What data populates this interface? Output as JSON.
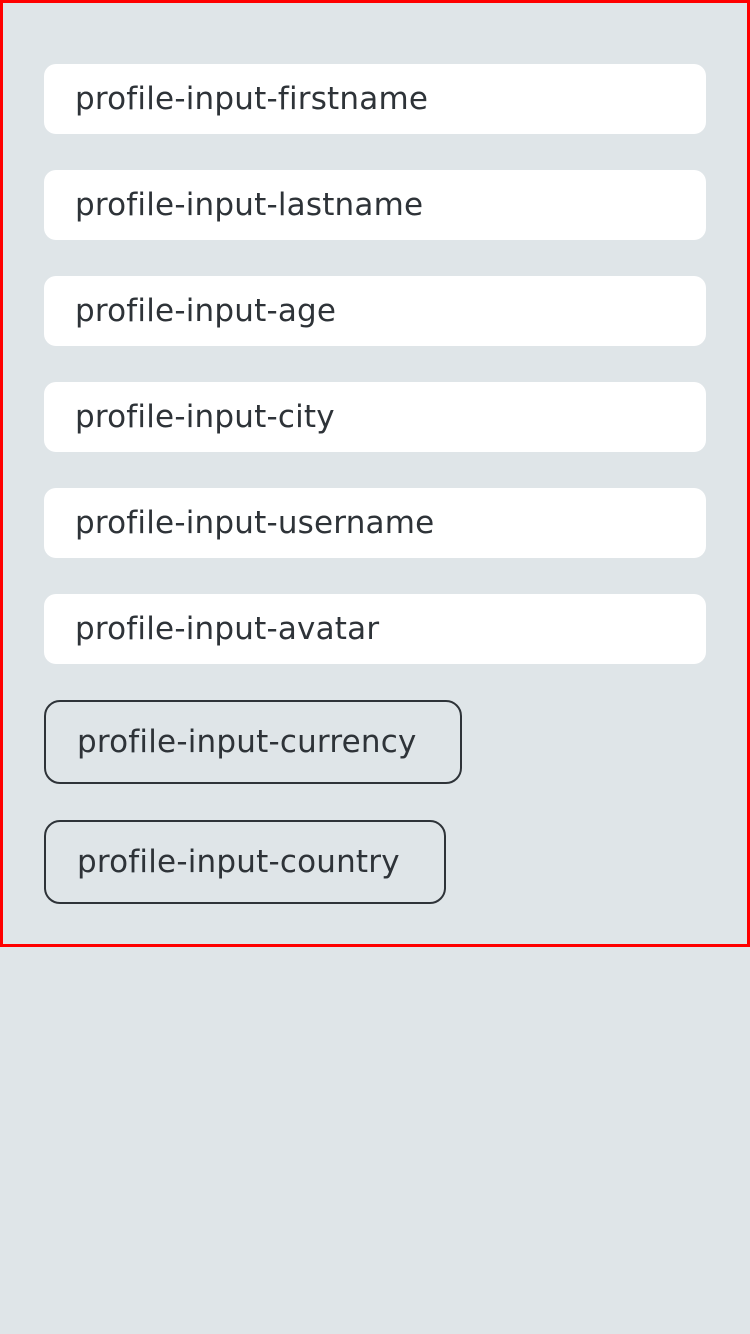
{
  "form": {
    "fields": [
      {
        "label": "profile-input-firstname"
      },
      {
        "label": "profile-input-lastname"
      },
      {
        "label": "profile-input-age"
      },
      {
        "label": "profile-input-city"
      },
      {
        "label": "profile-input-username"
      },
      {
        "label": "profile-input-avatar"
      }
    ],
    "selectors": [
      {
        "label": "profile-input-currency"
      },
      {
        "label": "profile-input-country"
      }
    ]
  }
}
